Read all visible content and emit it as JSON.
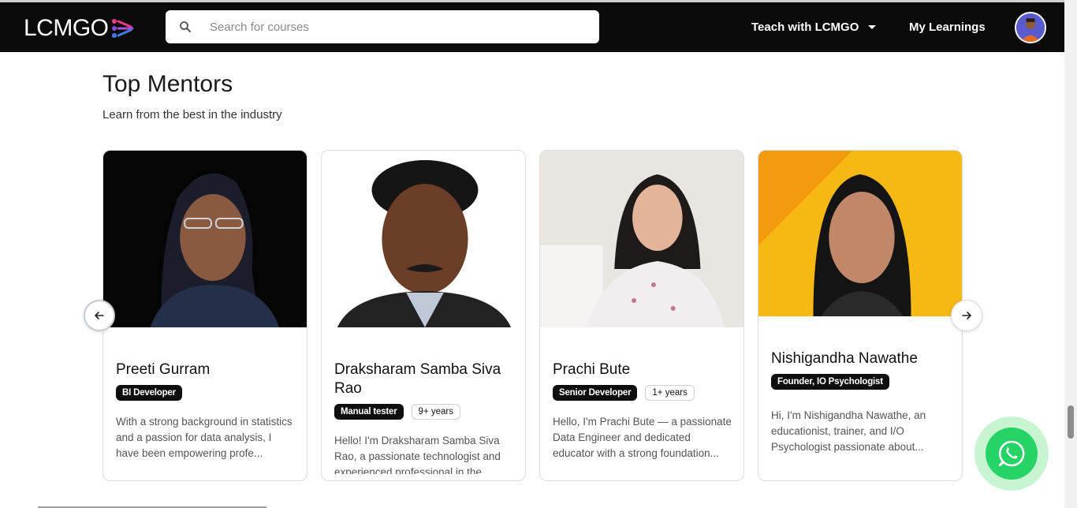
{
  "header": {
    "logo_text": "LCMGO",
    "search_placeholder": "Search for courses",
    "teach_label": "Teach with LCMGO",
    "my_learnings_label": "My Learnings"
  },
  "section": {
    "title": "Top Mentors",
    "subtitle": "Learn from the best in the industry"
  },
  "mentors": [
    {
      "name": "Preeti Gurram",
      "role": "BI Developer",
      "experience": "",
      "bio": "With a strong background in statistics and a passion for data analysis, I have been empowering profe..."
    },
    {
      "name": "Draksharam Samba Siva Rao",
      "role": "Manual tester",
      "experience": "9+ years",
      "bio": "Hello! I'm Draksharam Samba Siva Rao, a passionate technologist and experienced professional in the"
    },
    {
      "name": "Prachi Bute",
      "role": "Senior Developer",
      "experience": "1+ years",
      "bio": "Hello, I'm Prachi Bute — a passionate Data Engineer and dedicated educator with a strong foundation..."
    },
    {
      "name": "Nishigandha Nawathe",
      "role": "Founder, IO Psychologist",
      "experience": "",
      "bio": "Hi, I'm Nishigandha Nawathe, an educationist, trainer, and I/O Psychologist passionate about..."
    }
  ],
  "colors": {
    "topbar": "#0b0b0b",
    "whatsapp": "#25d366",
    "badge_dark": "#0e0e0e"
  },
  "icons": {
    "search": "search-icon",
    "prev": "arrow-left-icon",
    "next": "arrow-right-icon",
    "whatsapp": "whatsapp-icon",
    "dropdown": "chevron-down-icon"
  }
}
